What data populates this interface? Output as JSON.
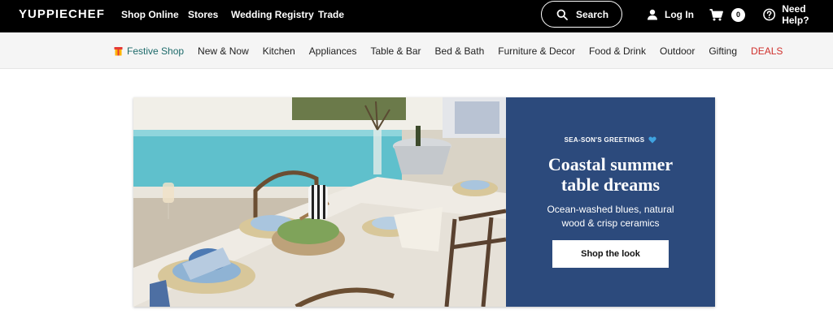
{
  "brand": "YUPPIECHEF",
  "top_nav": [
    "Shop Online",
    "Stores",
    "Wedding Registry",
    "Trade"
  ],
  "search": {
    "label": "Search"
  },
  "account": {
    "login_label": "Log In",
    "cart_count": "0",
    "help_label": "Need Help?"
  },
  "categories": {
    "festive": "Festive Shop",
    "items": [
      "New & Now",
      "Kitchen",
      "Appliances",
      "Table & Bar",
      "Bed & Bath",
      "Furniture & Decor",
      "Food & Drink",
      "Outdoor",
      "Gifting"
    ],
    "deals": "DEALS"
  },
  "hero": {
    "eyebrow": "SEA-SON'S GREETINGS",
    "title_line1": "Coastal summer",
    "title_line2": "table dreams",
    "sub_line1": "Ocean-washed blues, natural",
    "sub_line2": "wood & crisp ceramics",
    "cta": "Shop the look"
  },
  "colors": {
    "topbar": "#000000",
    "catbar": "#f5f5f5",
    "hero_panel": "#2c4a7c",
    "deals": "#d0312d",
    "festive": "#1e6b6b"
  }
}
